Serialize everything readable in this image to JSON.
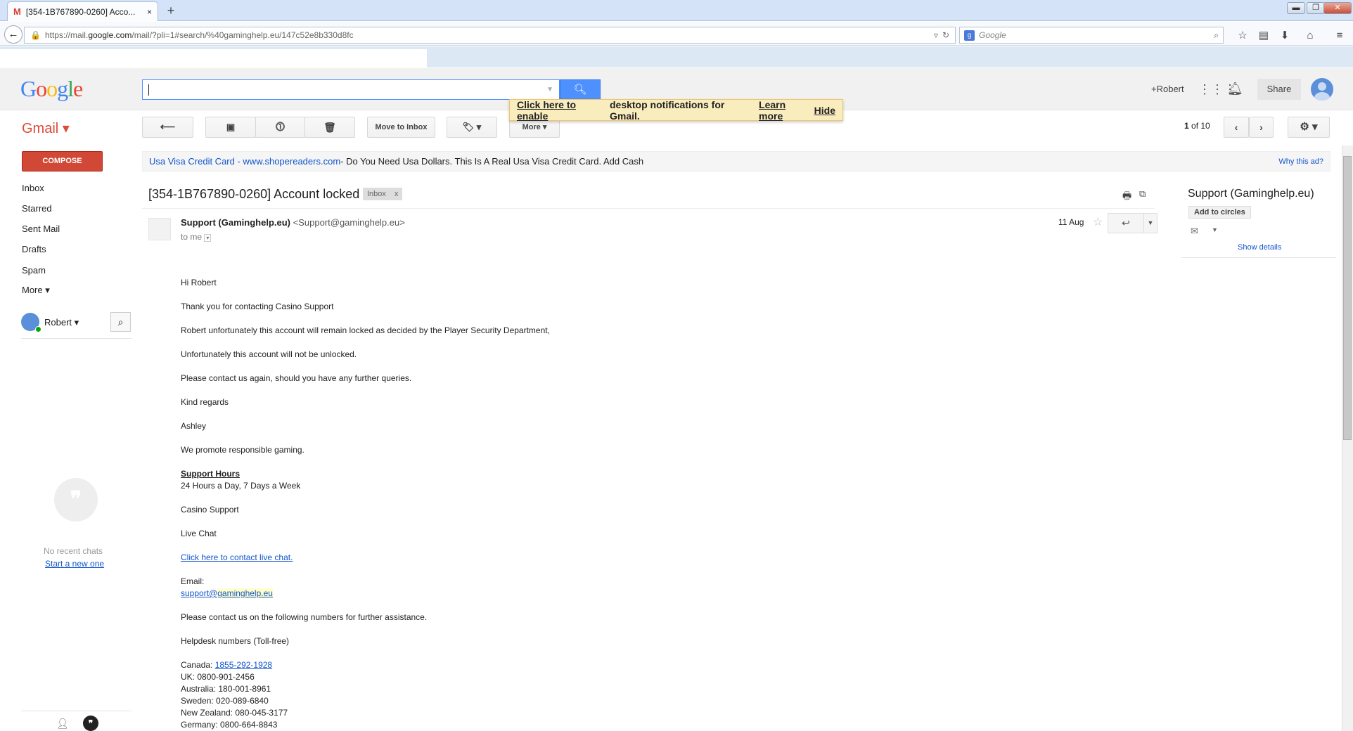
{
  "browser": {
    "tab_title": "[354-1B767890-0260] Acco...",
    "tab_close": "×",
    "new_tab": "+",
    "url_prefix": "https://mail.",
    "url_domain": "google.com",
    "url_rest": "/mail/?pli=1#search/%40gaminghelp.eu/147c52e8b330d8fc",
    "search_placeholder": "Google",
    "window_buttons": [
      "▬",
      "❐",
      "✕"
    ]
  },
  "header": {
    "logo": "Google",
    "search_value": "",
    "account": "+Robert",
    "share": "Share"
  },
  "notification": {
    "enable_link": "Click here to enable",
    "message": "desktop notifications for Gmail.",
    "learn_more": "Learn more",
    "hide": "Hide"
  },
  "toolbar": {
    "app_label": "Gmail ▾",
    "move_to_inbox": "Move to Inbox",
    "more": "More ▾",
    "pager_range": "1",
    "pager_total": " of 10"
  },
  "sidebar": {
    "compose": "COMPOSE",
    "items": [
      {
        "label": "Inbox"
      },
      {
        "label": "Starred"
      },
      {
        "label": "Sent Mail"
      },
      {
        "label": "Drafts"
      },
      {
        "label": "Spam"
      },
      {
        "label": "More ▾"
      }
    ],
    "user_name": "Robert ▾",
    "no_recent_chats": "No recent chats",
    "start_new": "Start a new one"
  },
  "ad": {
    "link": "Usa Visa Credit Card - www.shopereaders.com",
    "text": " - Do You Need Usa Dollars. This Is A Real Usa Visa Credit Card. Add Cash",
    "why": "Why this ad?"
  },
  "message": {
    "subject": "[354-1B767890-0260] Account locked",
    "label": "Inbox",
    "label_remove": "x",
    "sender_name": "Support (Gaminghelp.eu)",
    "sender_email": "<Support@gaminghelp.eu>",
    "to": "to me",
    "date": "11 Aug",
    "body": {
      "greeting": "Hi Robert",
      "p1": "Thank you for contacting Casino Support",
      "p2": "Robert unfortunately this account will remain locked as decided by the Player Security Department,",
      "p3": "Unfortunately this account will not be unlocked.",
      "p4": "Please contact us again, should you have any further queries.",
      "p5": "Kind regards",
      "p6": "Ashley",
      "p7": "We promote responsible gaming.",
      "hours_title": "Support Hours",
      "hours_text": "24 Hours a Day, 7 Days a Week",
      "casino_support": "Casino Support",
      "live_chat": "Live Chat",
      "live_chat_link": "Click here to contact live chat.",
      "email_label": "Email:",
      "email_user": "support@",
      "email_domain": "gaminghelp.eu",
      "contact_text": "Please contact us on the following numbers for further assistance.",
      "helpdesk": "Helpdesk numbers (Toll-free)",
      "numbers": [
        {
          "country": "Canada: ",
          "number": "1855-292-1928"
        },
        {
          "country": "UK: ",
          "number": "0800-901-2456"
        },
        {
          "country": "Australia: ",
          "number": "180-001-8961"
        },
        {
          "country": "Sweden: ",
          "number": "020-089-6840"
        },
        {
          "country": "New Zealand: ",
          "number": "080-045-3177"
        },
        {
          "country": "Germany: ",
          "number": "0800-664-8843"
        }
      ]
    }
  },
  "contact_panel": {
    "name": "Support (Gaminghelp.eu)",
    "add_to_circles": "Add to circles",
    "show_details": "Show details"
  }
}
